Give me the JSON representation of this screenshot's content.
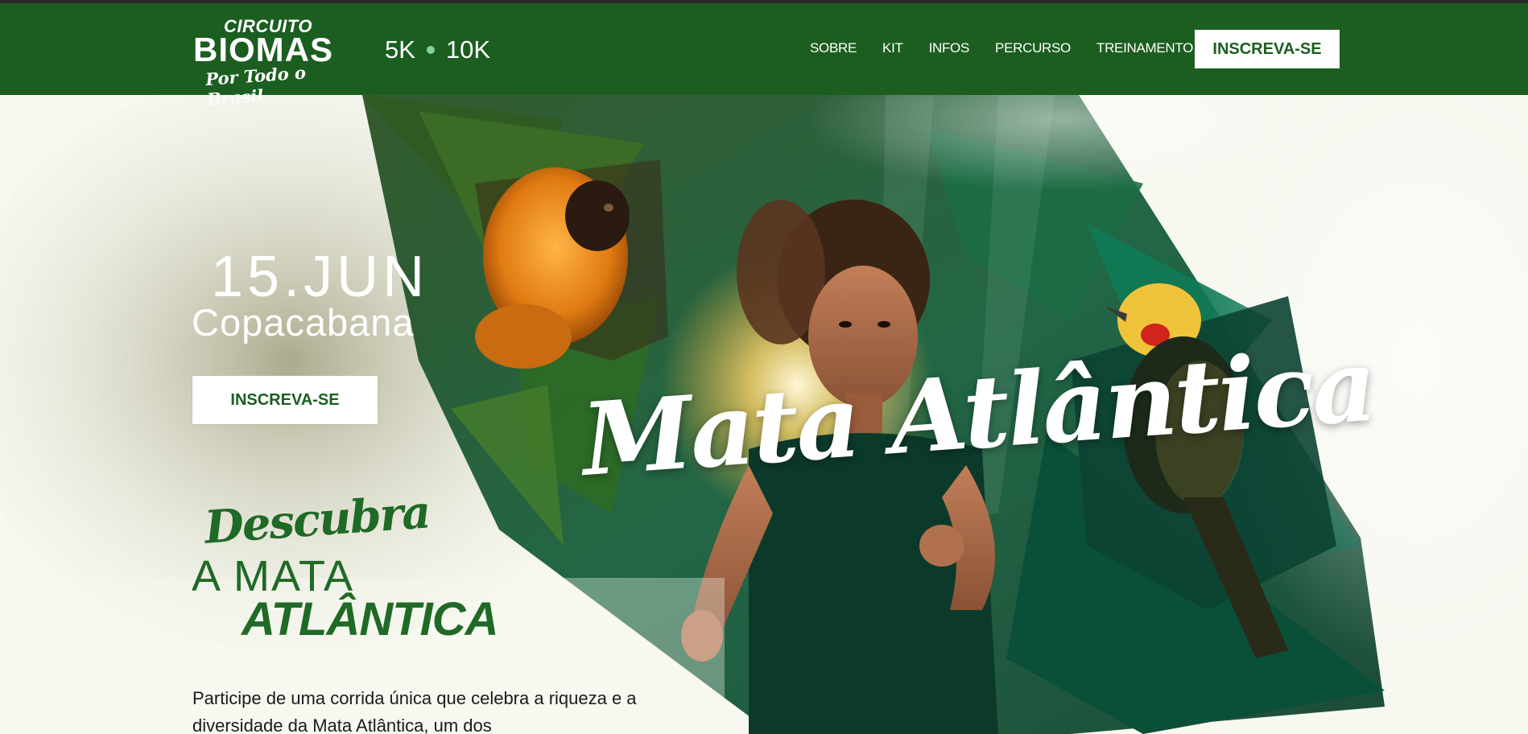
{
  "logo": {
    "line1": "CIRCUITO",
    "line2": "BIOMAS",
    "line3": "Por Todo o Brasil"
  },
  "distances": {
    "first": "5K",
    "second": "10K"
  },
  "nav": {
    "links": [
      "SOBRE",
      "KIT",
      "INFOS",
      "PERCURSO",
      "TREINAMENTO"
    ],
    "cta": "INSCREVA-SE"
  },
  "hero": {
    "date": "15.JUN",
    "city": "Copacabana",
    "cta": "INSCREVA-SE",
    "script_title": "Mata Atlântica",
    "discover": {
      "line1": "Descubra",
      "line2": "A MATA",
      "line3": "ATLÂNTICA"
    },
    "intro_text": "Participe de uma corrida única que celebra a riqueza e a diversidade da Mata Atlântica, um dos"
  },
  "colors": {
    "brand_green": "#1b5e20",
    "background": "#f7f8f0",
    "accent": "#7fd3a0"
  },
  "icons": [
    "tamarin-monkey-illustration",
    "runner-photo",
    "woodpecker-bird-illustration"
  ]
}
